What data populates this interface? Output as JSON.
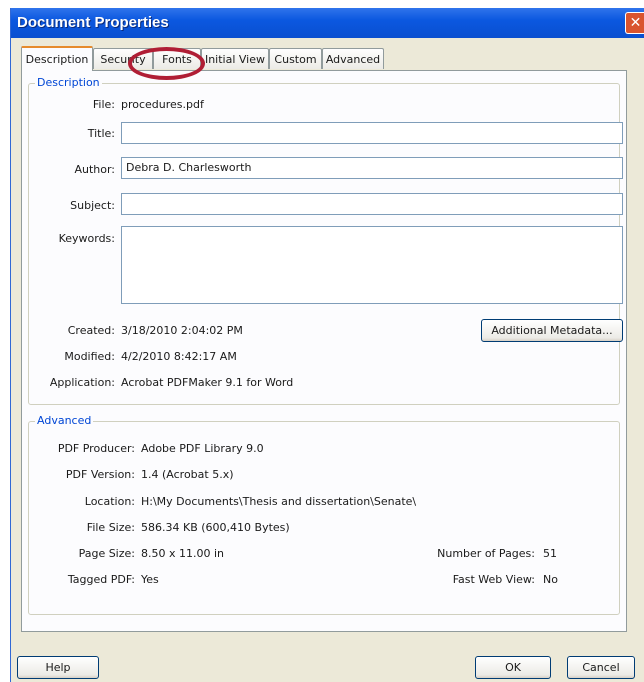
{
  "window": {
    "title": "Document Properties",
    "close_glyph": "✕"
  },
  "tabs": [
    {
      "label": "Description",
      "active": true
    },
    {
      "label": "Security"
    },
    {
      "label": "Fonts"
    },
    {
      "label": "Initial View"
    },
    {
      "label": "Custom"
    },
    {
      "label": "Advanced"
    }
  ],
  "description": {
    "group_title": "Description",
    "file_label": "File:",
    "file_value": "procedures.pdf",
    "title_label": "Title:",
    "title_value": "",
    "author_label": "Author:",
    "author_value": "Debra D. Charlesworth",
    "subject_label": "Subject:",
    "subject_value": "",
    "keywords_label": "Keywords:",
    "keywords_value": "",
    "created_label": "Created:",
    "created_value": "3/18/2010 2:04:02 PM",
    "modified_label": "Modified:",
    "modified_value": "4/2/2010 8:42:17 AM",
    "application_label": "Application:",
    "application_value": "Acrobat PDFMaker 9.1 for Word",
    "metadata_button": "Additional Metadata..."
  },
  "advanced": {
    "group_title": "Advanced",
    "producer_label": "PDF Producer:",
    "producer_value": "Adobe PDF Library 9.0",
    "version_label": "PDF Version:",
    "version_value": "1.4 (Acrobat 5.x)",
    "location_label": "Location:",
    "location_value": "H:\\My Documents\\Thesis and dissertation\\Senate\\",
    "filesize_label": "File Size:",
    "filesize_value": "586.34 KB (600,410 Bytes)",
    "pagesize_label": "Page Size:",
    "pagesize_value": "8.50 x 11.00 in",
    "pages_label": "Number of Pages:",
    "pages_value": "51",
    "tagged_label": "Tagged PDF:",
    "tagged_value": "Yes",
    "fastweb_label": "Fast Web View:",
    "fastweb_value": "No"
  },
  "footer": {
    "help_button": "Help",
    "ok_button": "OK",
    "cancel_button": "Cancel"
  },
  "annotation": {
    "color": "#b01e35",
    "marks": "Security / Fonts tabs"
  }
}
